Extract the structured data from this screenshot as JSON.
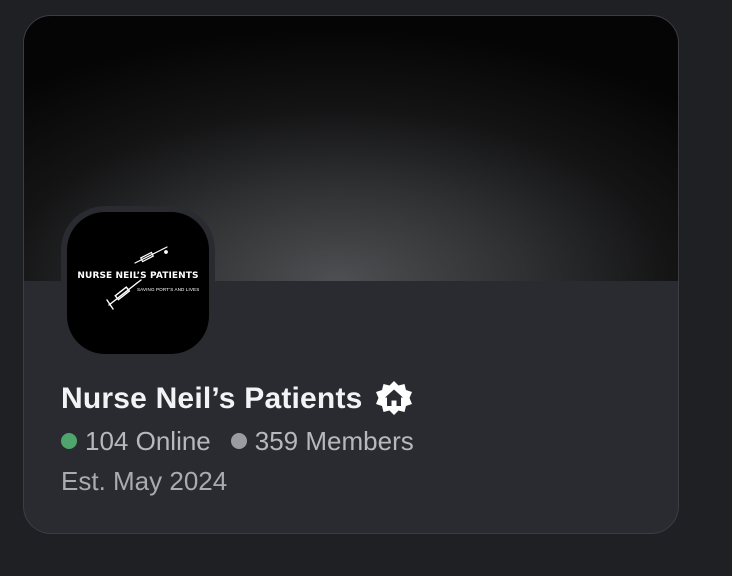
{
  "server": {
    "name": "Nurse Neil’s Patients",
    "badge_icon": "community-home-badge-icon",
    "logo": {
      "title": "NURSE NEIL’S PATIENTS",
      "tagline": "SAVING PORT’S AND LIVES"
    },
    "online_count": "104 Online",
    "member_count": "359 Members",
    "established": "Est. May 2024"
  },
  "colors": {
    "online_dot": "#4fa66c",
    "members_dot": "#9a9ca2",
    "card_bg": "#2a2b30",
    "page_bg": "#1f2024"
  }
}
